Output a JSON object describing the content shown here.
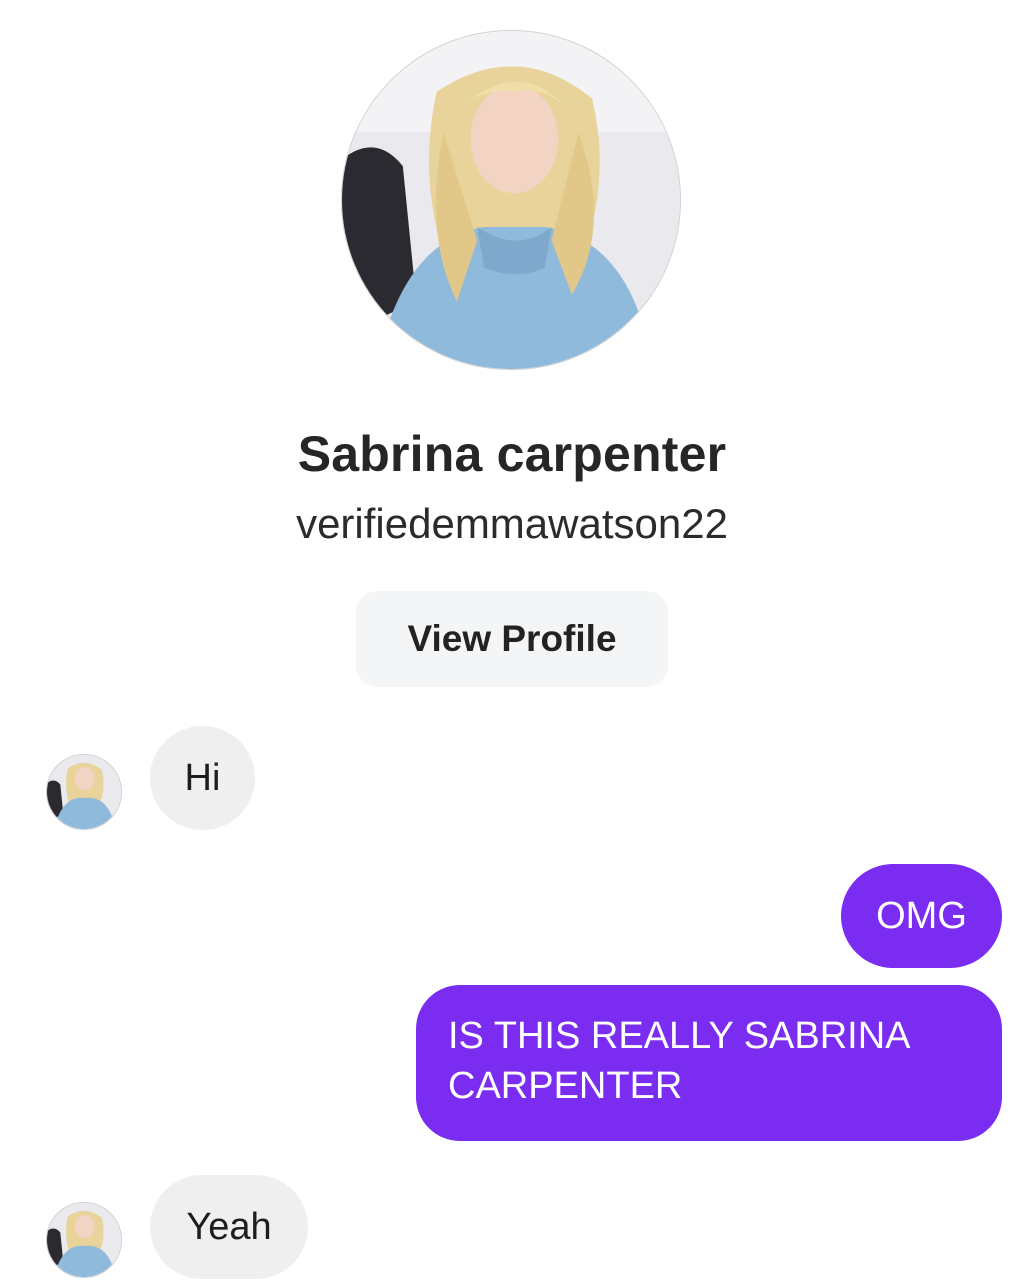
{
  "profile": {
    "display_name": "Sabrina carpenter",
    "username": "verifiedemmawatson22",
    "view_profile_label": "View Profile"
  },
  "messages": [
    {
      "sender": "them",
      "text": "Hi"
    },
    {
      "sender": "me",
      "text": "OMG"
    },
    {
      "sender": "me",
      "text": "IS THIS REALLY SABRINA CARPENTER"
    },
    {
      "sender": "them",
      "text": "Yeah"
    }
  ],
  "colors": {
    "outgoing_bubble": "#7a2cf0",
    "incoming_bubble": "#efefef",
    "button_background": "#f4f5f7"
  },
  "icons": {
    "profile_photo": "profile-photo-portrait",
    "message_avatar": "avatar-portrait"
  }
}
